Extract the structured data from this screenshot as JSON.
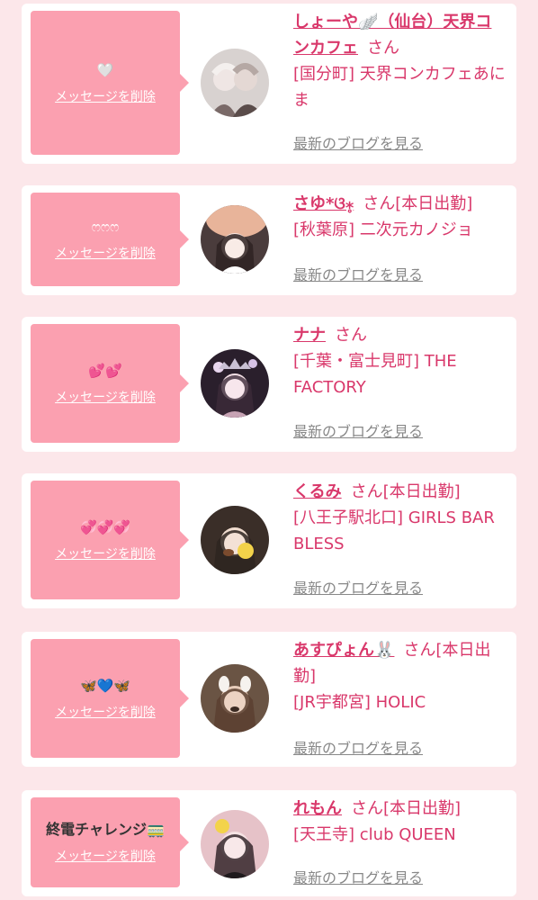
{
  "cards": [
    {
      "message": "🤍",
      "message_style": "white",
      "delete_label": "メッセージを削除",
      "name": "しょーや🪽（仙台）天界コンカフェ",
      "suffix": "さん",
      "shop": "[国分町] 天界コンカフェあにま",
      "blog_label": "最新のブログを見る",
      "avatar_colors": [
        "#d8d2d0",
        "#7a6a68"
      ]
    },
    {
      "message": "ෆෆෆ",
      "message_style": "white",
      "delete_label": "メッセージを削除",
      "name": "さゆ*ଓ⁎̥",
      "suffix": "さん[本日出勤]",
      "shop": "[秋葉原] 二次元カノジョ",
      "blog_label": "最新のブログを見る",
      "avatar_colors": [
        "#e8b49a",
        "#3a2a2a"
      ]
    },
    {
      "message": "💕💕",
      "message_style": "pink",
      "delete_label": "メッセージを削除",
      "name": "ナナ",
      "suffix": "さん",
      "shop": "[千葉・富士見町] THE FACTORY",
      "blog_label": "最新のブログを見る",
      "avatar_colors": [
        "#c7a3b4",
        "#3c2b3a"
      ]
    },
    {
      "message": "💞💞💞",
      "message_style": "pink",
      "delete_label": "メッセージを削除",
      "name": "くるみ",
      "suffix": "さん[本日出勤]",
      "shop": "[八王子駅北口] GIRLS BAR BLESS",
      "blog_label": "最新のブログを見る",
      "avatar_colors": [
        "#d9b8a0",
        "#2e2420"
      ]
    },
    {
      "message": "🦋💙🦋",
      "message_style": "blue",
      "delete_label": "メッセージを削除",
      "name": "あすぴょん🐰",
      "suffix": "さん[本日出勤]",
      "shop": "[JR宇都宮] HOLIC",
      "blog_label": "最新のブログを見る",
      "avatar_colors": [
        "#b79a80",
        "#5a4030"
      ]
    },
    {
      "message": "終電チャレンジ🚃",
      "message_style": "dark",
      "delete_label": "メッセージを削除",
      "name": "れもん",
      "suffix": "さん[本日出勤]",
      "shop": "[天王寺] club QUEEN",
      "blog_label": "最新のブログを見る",
      "avatar_colors": [
        "#e6c2c8",
        "#2a1d22"
      ]
    }
  ],
  "colors": {
    "page_bg": "#fce7ea",
    "bubble": "#fba0b0",
    "accent": "#d9386b",
    "blog_link": "#888888"
  }
}
